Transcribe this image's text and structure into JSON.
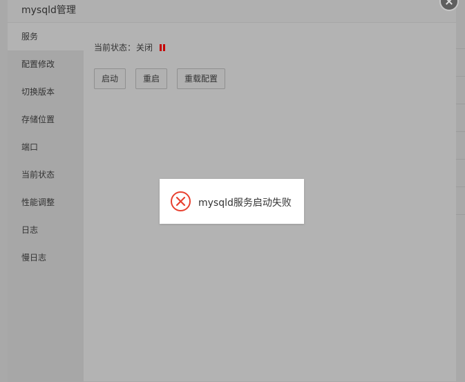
{
  "dialog": {
    "title": "mysqld管理"
  },
  "sidebar": {
    "items": [
      {
        "label": "服务",
        "active": true
      },
      {
        "label": "配置修改"
      },
      {
        "label": "切换版本"
      },
      {
        "label": "存储位置"
      },
      {
        "label": "端口"
      },
      {
        "label": "当前状态"
      },
      {
        "label": "性能调整"
      },
      {
        "label": "日志"
      },
      {
        "label": "慢日志"
      }
    ]
  },
  "service": {
    "status_label": "当前状态：",
    "status_value": "关闭",
    "status_icon": "pause-icon",
    "status_color": "#c60000",
    "buttons": {
      "start": "启动",
      "restart": "重启",
      "reload": "重载配置"
    }
  },
  "toast": {
    "icon": "error-circle-icon",
    "icon_color": "#e8402f",
    "message": "mysqld服务启动失败"
  }
}
